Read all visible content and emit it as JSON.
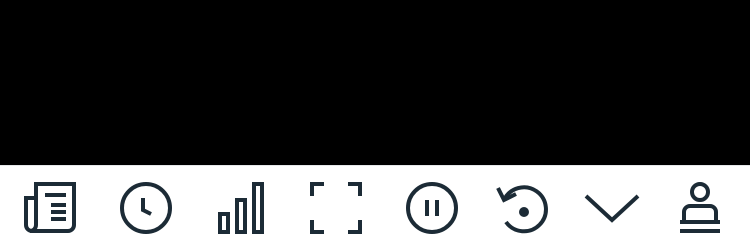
{
  "colors": {
    "viewport_background": "#000000",
    "toolbar_background": "#ffffff",
    "icon_stroke": "#1c2b36"
  },
  "toolbar": {
    "buttons": [
      {
        "id": "transcript",
        "icon": "document-icon"
      },
      {
        "id": "history",
        "icon": "clock-icon"
      },
      {
        "id": "quality",
        "icon": "signal-bars-icon"
      },
      {
        "id": "fullscreen",
        "icon": "fullscreen-icon"
      },
      {
        "id": "pause",
        "icon": "pause-icon"
      },
      {
        "id": "replay",
        "icon": "replay-icon"
      },
      {
        "id": "collapse",
        "icon": "chevron-down-icon"
      },
      {
        "id": "profile",
        "icon": "user-icon"
      }
    ]
  }
}
